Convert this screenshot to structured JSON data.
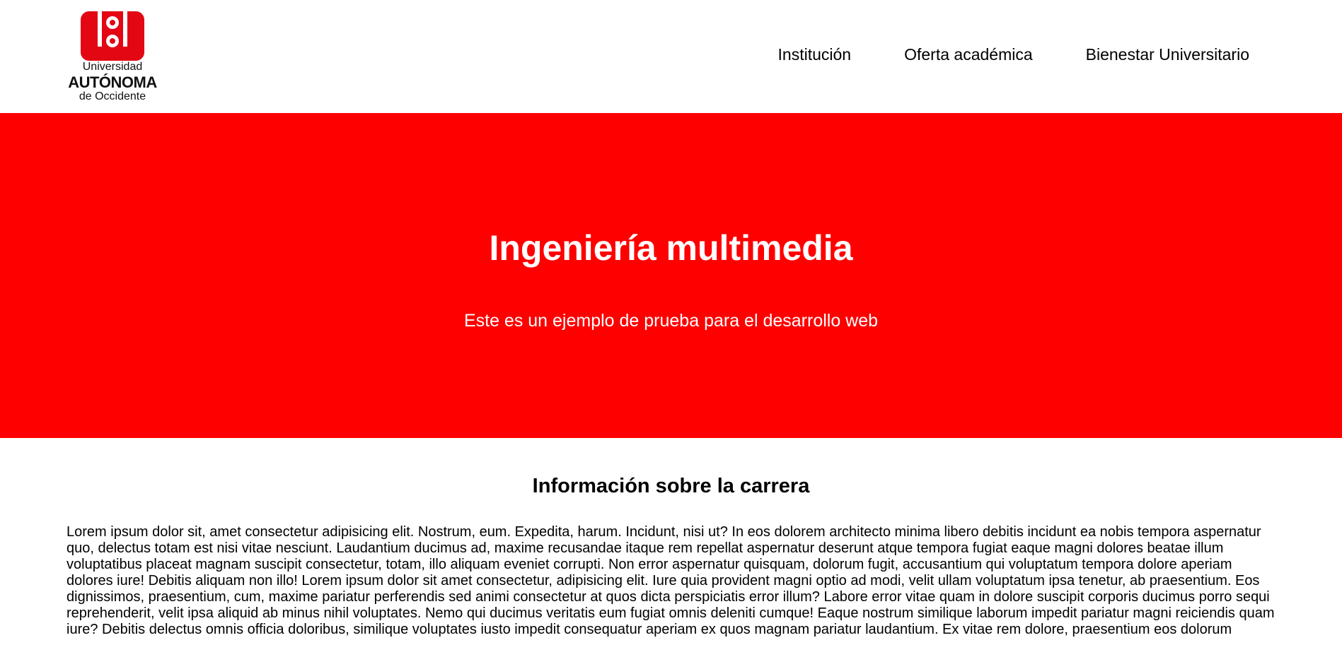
{
  "brand": {
    "line1": "Universidad",
    "line2": "AUTÓNOMA",
    "line3": "de Occidente",
    "color": "#e30613"
  },
  "nav": {
    "items": [
      {
        "label": "Institución"
      },
      {
        "label": "Oferta académica"
      },
      {
        "label": "Bienestar Universitario"
      }
    ]
  },
  "hero": {
    "title": "Ingeniería multimedia",
    "subtitle": "Este es un ejemplo de prueba para el desarrollo web",
    "background": "#ff0000"
  },
  "info": {
    "heading": "Información sobre la carrera",
    "body": "Lorem ipsum dolor sit, amet consectetur adipisicing elit. Nostrum, eum. Expedita, harum. Incidunt, nisi ut? In eos dolorem architecto minima libero debitis incidunt ea nobis tempora aspernatur quo, delectus totam est nisi vitae nesciunt. Laudantium ducimus ad, maxime recusandae itaque rem repellat aspernatur deserunt atque tempora fugiat eaque magni dolores beatae illum voluptatibus placeat magnam suscipit consectetur, totam, illo aliquam eveniet corrupti. Non error aspernatur quisquam, dolorum fugit, accusantium qui voluptatum tempora dolore aperiam dolores iure! Debitis aliquam non illo! Lorem ipsum dolor sit amet consectetur, adipisicing elit. Iure quia provident magni optio ad modi, velit ullam voluptatum ipsa tenetur, ab praesentium. Eos dignissimos, praesentium, cum, maxime pariatur perferendis sed animi consectetur at quos dicta perspiciatis error illum? Labore error vitae quam in dolore suscipit corporis ducimus porro sequi reprehenderit, velit ipsa aliquid ab minus nihil voluptates. Nemo qui ducimus veritatis eum fugiat omnis deleniti cumque! Eaque nostrum similique laborum impedit pariatur magni reiciendis quam iure? Debitis delectus omnis officia doloribus, similique voluptates iusto impedit consequatur aperiam ex quos magnam pariatur laudantium. Ex vitae rem dolore, praesentium eos dolorum"
  }
}
